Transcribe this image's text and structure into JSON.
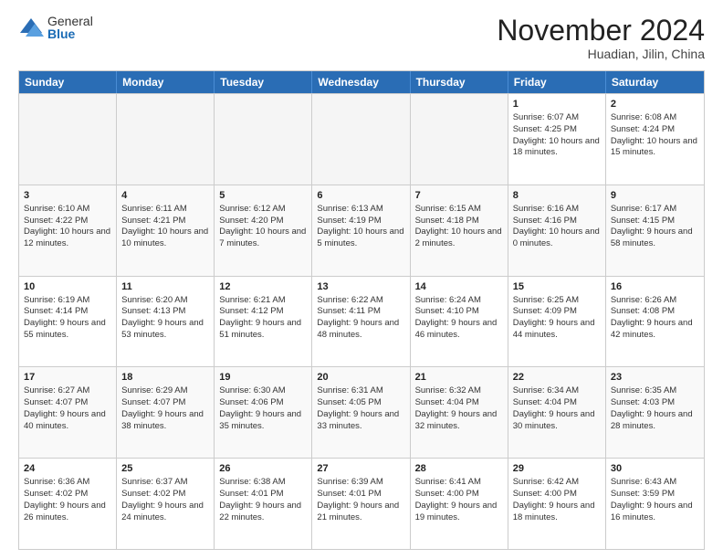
{
  "logo": {
    "general": "General",
    "blue": "Blue"
  },
  "title": "November 2024",
  "location": "Huadian, Jilin, China",
  "days_header": [
    "Sunday",
    "Monday",
    "Tuesday",
    "Wednesday",
    "Thursday",
    "Friday",
    "Saturday"
  ],
  "rows": [
    [
      {
        "day": "",
        "text": "",
        "empty": true
      },
      {
        "day": "",
        "text": "",
        "empty": true
      },
      {
        "day": "",
        "text": "",
        "empty": true
      },
      {
        "day": "",
        "text": "",
        "empty": true
      },
      {
        "day": "",
        "text": "",
        "empty": true
      },
      {
        "day": "1",
        "text": "Sunrise: 6:07 AM\nSunset: 4:25 PM\nDaylight: 10 hours and 18 minutes.",
        "empty": false
      },
      {
        "day": "2",
        "text": "Sunrise: 6:08 AM\nSunset: 4:24 PM\nDaylight: 10 hours and 15 minutes.",
        "empty": false
      }
    ],
    [
      {
        "day": "3",
        "text": "Sunrise: 6:10 AM\nSunset: 4:22 PM\nDaylight: 10 hours and 12 minutes.",
        "empty": false
      },
      {
        "day": "4",
        "text": "Sunrise: 6:11 AM\nSunset: 4:21 PM\nDaylight: 10 hours and 10 minutes.",
        "empty": false
      },
      {
        "day": "5",
        "text": "Sunrise: 6:12 AM\nSunset: 4:20 PM\nDaylight: 10 hours and 7 minutes.",
        "empty": false
      },
      {
        "day": "6",
        "text": "Sunrise: 6:13 AM\nSunset: 4:19 PM\nDaylight: 10 hours and 5 minutes.",
        "empty": false
      },
      {
        "day": "7",
        "text": "Sunrise: 6:15 AM\nSunset: 4:18 PM\nDaylight: 10 hours and 2 minutes.",
        "empty": false
      },
      {
        "day": "8",
        "text": "Sunrise: 6:16 AM\nSunset: 4:16 PM\nDaylight: 10 hours and 0 minutes.",
        "empty": false
      },
      {
        "day": "9",
        "text": "Sunrise: 6:17 AM\nSunset: 4:15 PM\nDaylight: 9 hours and 58 minutes.",
        "empty": false
      }
    ],
    [
      {
        "day": "10",
        "text": "Sunrise: 6:19 AM\nSunset: 4:14 PM\nDaylight: 9 hours and 55 minutes.",
        "empty": false
      },
      {
        "day": "11",
        "text": "Sunrise: 6:20 AM\nSunset: 4:13 PM\nDaylight: 9 hours and 53 minutes.",
        "empty": false
      },
      {
        "day": "12",
        "text": "Sunrise: 6:21 AM\nSunset: 4:12 PM\nDaylight: 9 hours and 51 minutes.",
        "empty": false
      },
      {
        "day": "13",
        "text": "Sunrise: 6:22 AM\nSunset: 4:11 PM\nDaylight: 9 hours and 48 minutes.",
        "empty": false
      },
      {
        "day": "14",
        "text": "Sunrise: 6:24 AM\nSunset: 4:10 PM\nDaylight: 9 hours and 46 minutes.",
        "empty": false
      },
      {
        "day": "15",
        "text": "Sunrise: 6:25 AM\nSunset: 4:09 PM\nDaylight: 9 hours and 44 minutes.",
        "empty": false
      },
      {
        "day": "16",
        "text": "Sunrise: 6:26 AM\nSunset: 4:08 PM\nDaylight: 9 hours and 42 minutes.",
        "empty": false
      }
    ],
    [
      {
        "day": "17",
        "text": "Sunrise: 6:27 AM\nSunset: 4:07 PM\nDaylight: 9 hours and 40 minutes.",
        "empty": false
      },
      {
        "day": "18",
        "text": "Sunrise: 6:29 AM\nSunset: 4:07 PM\nDaylight: 9 hours and 38 minutes.",
        "empty": false
      },
      {
        "day": "19",
        "text": "Sunrise: 6:30 AM\nSunset: 4:06 PM\nDaylight: 9 hours and 35 minutes.",
        "empty": false
      },
      {
        "day": "20",
        "text": "Sunrise: 6:31 AM\nSunset: 4:05 PM\nDaylight: 9 hours and 33 minutes.",
        "empty": false
      },
      {
        "day": "21",
        "text": "Sunrise: 6:32 AM\nSunset: 4:04 PM\nDaylight: 9 hours and 32 minutes.",
        "empty": false
      },
      {
        "day": "22",
        "text": "Sunrise: 6:34 AM\nSunset: 4:04 PM\nDaylight: 9 hours and 30 minutes.",
        "empty": false
      },
      {
        "day": "23",
        "text": "Sunrise: 6:35 AM\nSunset: 4:03 PM\nDaylight: 9 hours and 28 minutes.",
        "empty": false
      }
    ],
    [
      {
        "day": "24",
        "text": "Sunrise: 6:36 AM\nSunset: 4:02 PM\nDaylight: 9 hours and 26 minutes.",
        "empty": false
      },
      {
        "day": "25",
        "text": "Sunrise: 6:37 AM\nSunset: 4:02 PM\nDaylight: 9 hours and 24 minutes.",
        "empty": false
      },
      {
        "day": "26",
        "text": "Sunrise: 6:38 AM\nSunset: 4:01 PM\nDaylight: 9 hours and 22 minutes.",
        "empty": false
      },
      {
        "day": "27",
        "text": "Sunrise: 6:39 AM\nSunset: 4:01 PM\nDaylight: 9 hours and 21 minutes.",
        "empty": false
      },
      {
        "day": "28",
        "text": "Sunrise: 6:41 AM\nSunset: 4:00 PM\nDaylight: 9 hours and 19 minutes.",
        "empty": false
      },
      {
        "day": "29",
        "text": "Sunrise: 6:42 AM\nSunset: 4:00 PM\nDaylight: 9 hours and 18 minutes.",
        "empty": false
      },
      {
        "day": "30",
        "text": "Sunrise: 6:43 AM\nSunset: 3:59 PM\nDaylight: 9 hours and 16 minutes.",
        "empty": false
      }
    ]
  ]
}
